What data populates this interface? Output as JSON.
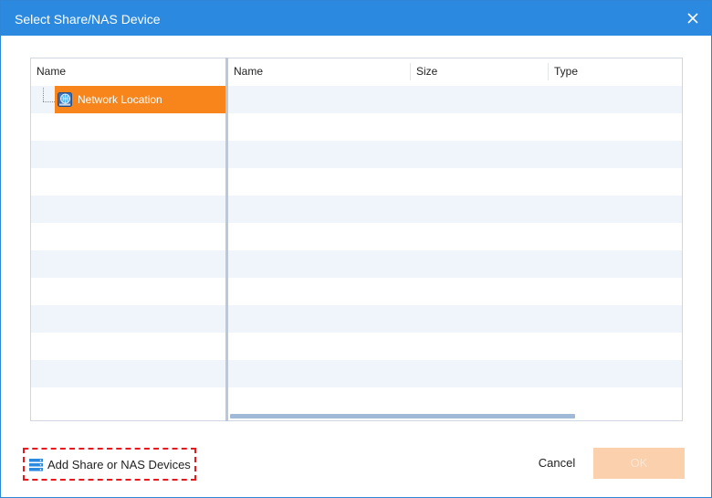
{
  "window": {
    "title": "Select Share/NAS Device",
    "accent_color": "#2b8ae0"
  },
  "tree": {
    "header": "Name",
    "nodes": [
      {
        "label": "Network Location",
        "icon": "network-globe-icon",
        "selected": true,
        "highlight_color": "#f7851c"
      }
    ]
  },
  "list": {
    "columns": [
      "Name",
      "Size",
      "Type"
    ],
    "rows": []
  },
  "footer": {
    "add_share_label": "Add Share or NAS Devices",
    "cancel_label": "Cancel",
    "ok_label": "OK",
    "ok_enabled": false
  }
}
